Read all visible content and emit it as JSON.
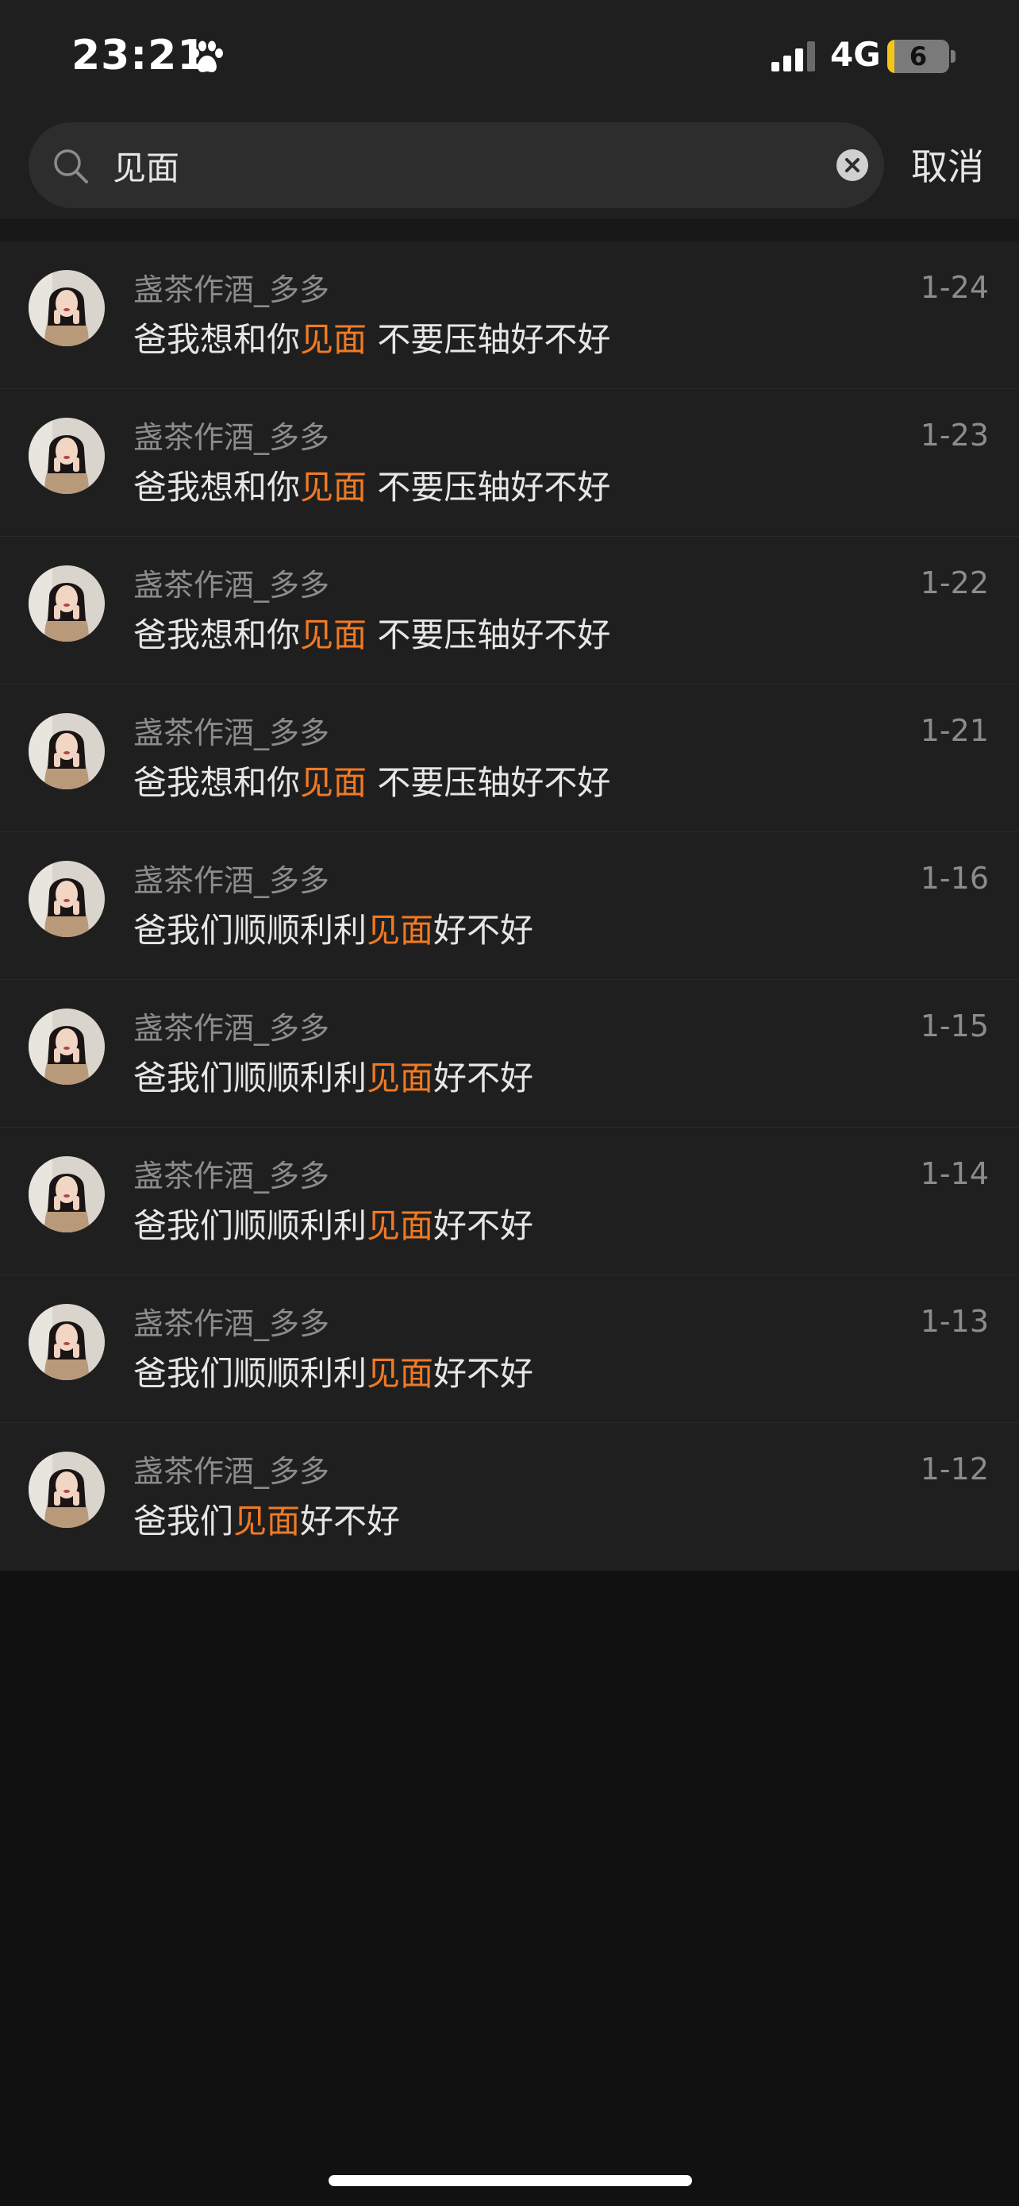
{
  "status_bar": {
    "time": "23:21",
    "network": "4G",
    "battery_level": "6",
    "battery_fraction": 0.06,
    "battery_fill_color": "#f5c518",
    "icons": [
      "paw-icon",
      "signal-icon",
      "battery-icon"
    ]
  },
  "search": {
    "query": "见面",
    "cancel_label": "取消",
    "highlight_color": "#f07a24"
  },
  "results": [
    {
      "sender": "盏茶作酒_多多",
      "date": "1-24",
      "before": "爸我想和你",
      "match": "见面",
      "after": " 不要压轴好不好"
    },
    {
      "sender": "盏茶作酒_多多",
      "date": "1-23",
      "before": "爸我想和你",
      "match": "见面",
      "after": " 不要压轴好不好"
    },
    {
      "sender": "盏茶作酒_多多",
      "date": "1-22",
      "before": "爸我想和你",
      "match": "见面",
      "after": " 不要压轴好不好"
    },
    {
      "sender": "盏茶作酒_多多",
      "date": "1-21",
      "before": "爸我想和你",
      "match": "见面",
      "after": " 不要压轴好不好"
    },
    {
      "sender": "盏茶作酒_多多",
      "date": "1-16",
      "before": "爸我们顺顺利利",
      "match": "见面",
      "after": "好不好"
    },
    {
      "sender": "盏茶作酒_多多",
      "date": "1-15",
      "before": "爸我们顺顺利利",
      "match": "见面",
      "after": "好不好"
    },
    {
      "sender": "盏茶作酒_多多",
      "date": "1-14",
      "before": "爸我们顺顺利利",
      "match": "见面",
      "after": "好不好"
    },
    {
      "sender": "盏茶作酒_多多",
      "date": "1-13",
      "before": "爸我们顺顺利利",
      "match": "见面",
      "after": "好不好"
    },
    {
      "sender": "盏茶作酒_多多",
      "date": "1-12",
      "before": "爸我们",
      "match": "见面",
      "after": "好不好"
    }
  ]
}
